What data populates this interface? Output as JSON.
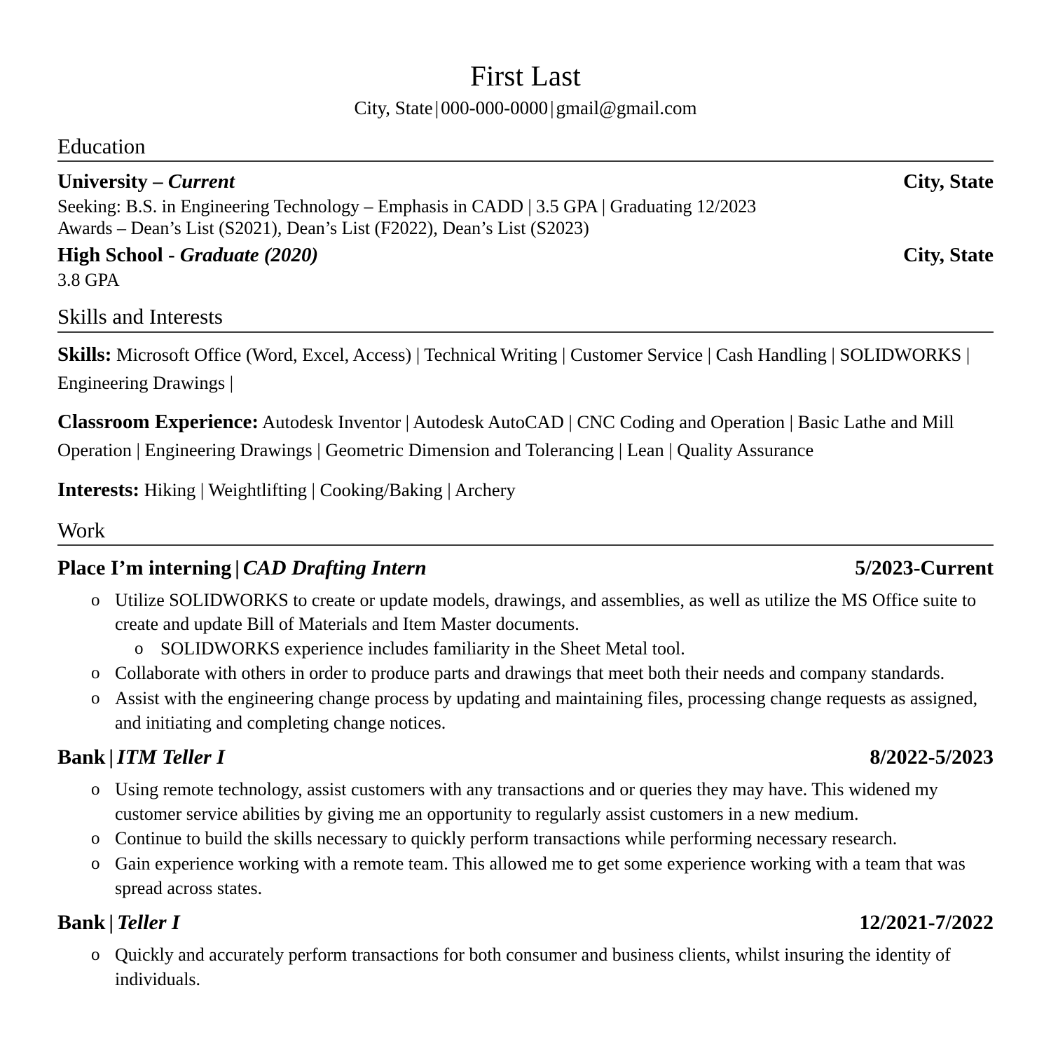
{
  "header": {
    "name": "First Last",
    "location": "City, State",
    "separator": "|",
    "phone": "000-000-0000",
    "email": "gmail@gmail.com"
  },
  "sections": {
    "education": {
      "title": "Education",
      "entries": [
        {
          "institution": "University",
          "dash": "–",
          "status": "Current",
          "location": "City, State",
          "lines": [
            "Seeking: B.S. in Engineering Technology – Emphasis in CADD | 3.5 GPA | Graduating 12/2023",
            "Awards – Dean’s List (S2021), Dean’s List (F2022), Dean’s List (S2023)"
          ]
        },
        {
          "institution": "High School",
          "dash": "-",
          "status": "Graduate (2020)",
          "location": "City, State",
          "lines": [
            "3.8 GPA"
          ]
        }
      ]
    },
    "skills": {
      "title": "Skills and Interests",
      "groups": [
        {
          "label": "Skills:",
          "value": "Microsoft Office (Word, Excel, Access) | Technical Writing | Customer Service | Cash Handling | SOLIDWORKS | Engineering Drawings |"
        },
        {
          "label": "Classroom Experience:",
          "value": "Autodesk Inventor | Autodesk AutoCAD | CNC Coding and Operation | Basic Lathe and Mill Operation | Engineering Drawings | Geometric Dimension and Tolerancing | Lean | Quality Assurance"
        },
        {
          "label": "Interests:",
          "value": "Hiking | Weightlifting | Cooking/Baking | Archery"
        }
      ]
    },
    "work": {
      "title": "Work",
      "jobs": [
        {
          "company": "Place I’m interning",
          "pipe": "|",
          "title": "CAD Drafting Intern",
          "dates": "5/2023-Current",
          "bullets": [
            {
              "marker": "o",
              "text": "Utilize SOLIDWORKS to create or update models, drawings, and assemblies, as well as utilize the MS Office suite to create and update Bill of Materials and Item Master documents.",
              "sub": [
                {
                  "marker": "o",
                  "text": "SOLIDWORKS experience includes familiarity in the Sheet Metal tool."
                }
              ]
            },
            {
              "marker": "o",
              "text": "Collaborate with others in order to produce parts and drawings that meet both their needs and company standards.",
              "sub": []
            },
            {
              "marker": "o",
              "text": "Assist with the engineering change process by updating and maintaining files, processing change requests as assigned, and initiating and completing change notices.",
              "sub": []
            }
          ]
        },
        {
          "company": "Bank",
          "pipe": "|",
          "title": "ITM Teller I",
          "dates": "8/2022-5/2023",
          "bullets": [
            {
              "marker": "o",
              "text": "Using remote technology, assist customers with any transactions and or queries they may have. This widened my customer service abilities by giving me an opportunity to regularly assist customers in a new medium.",
              "sub": []
            },
            {
              "marker": "o",
              "text": " Continue to build the skills necessary to quickly perform transactions while performing necessary research.",
              "sub": []
            },
            {
              "marker": "o",
              "text": "Gain experience working with a remote team. This allowed me to get some experience working with a team that was spread across states.",
              "sub": []
            }
          ]
        },
        {
          "company": "Bank",
          "pipe": "|",
          "title": "Teller I",
          "dates": "12/2021-7/2022",
          "bullets": [
            {
              "marker": "o",
              "text": "Quickly and accurately perform transactions for both consumer and business clients, whilst insuring the identity of individuals.",
              "sub": []
            }
          ]
        }
      ]
    }
  }
}
